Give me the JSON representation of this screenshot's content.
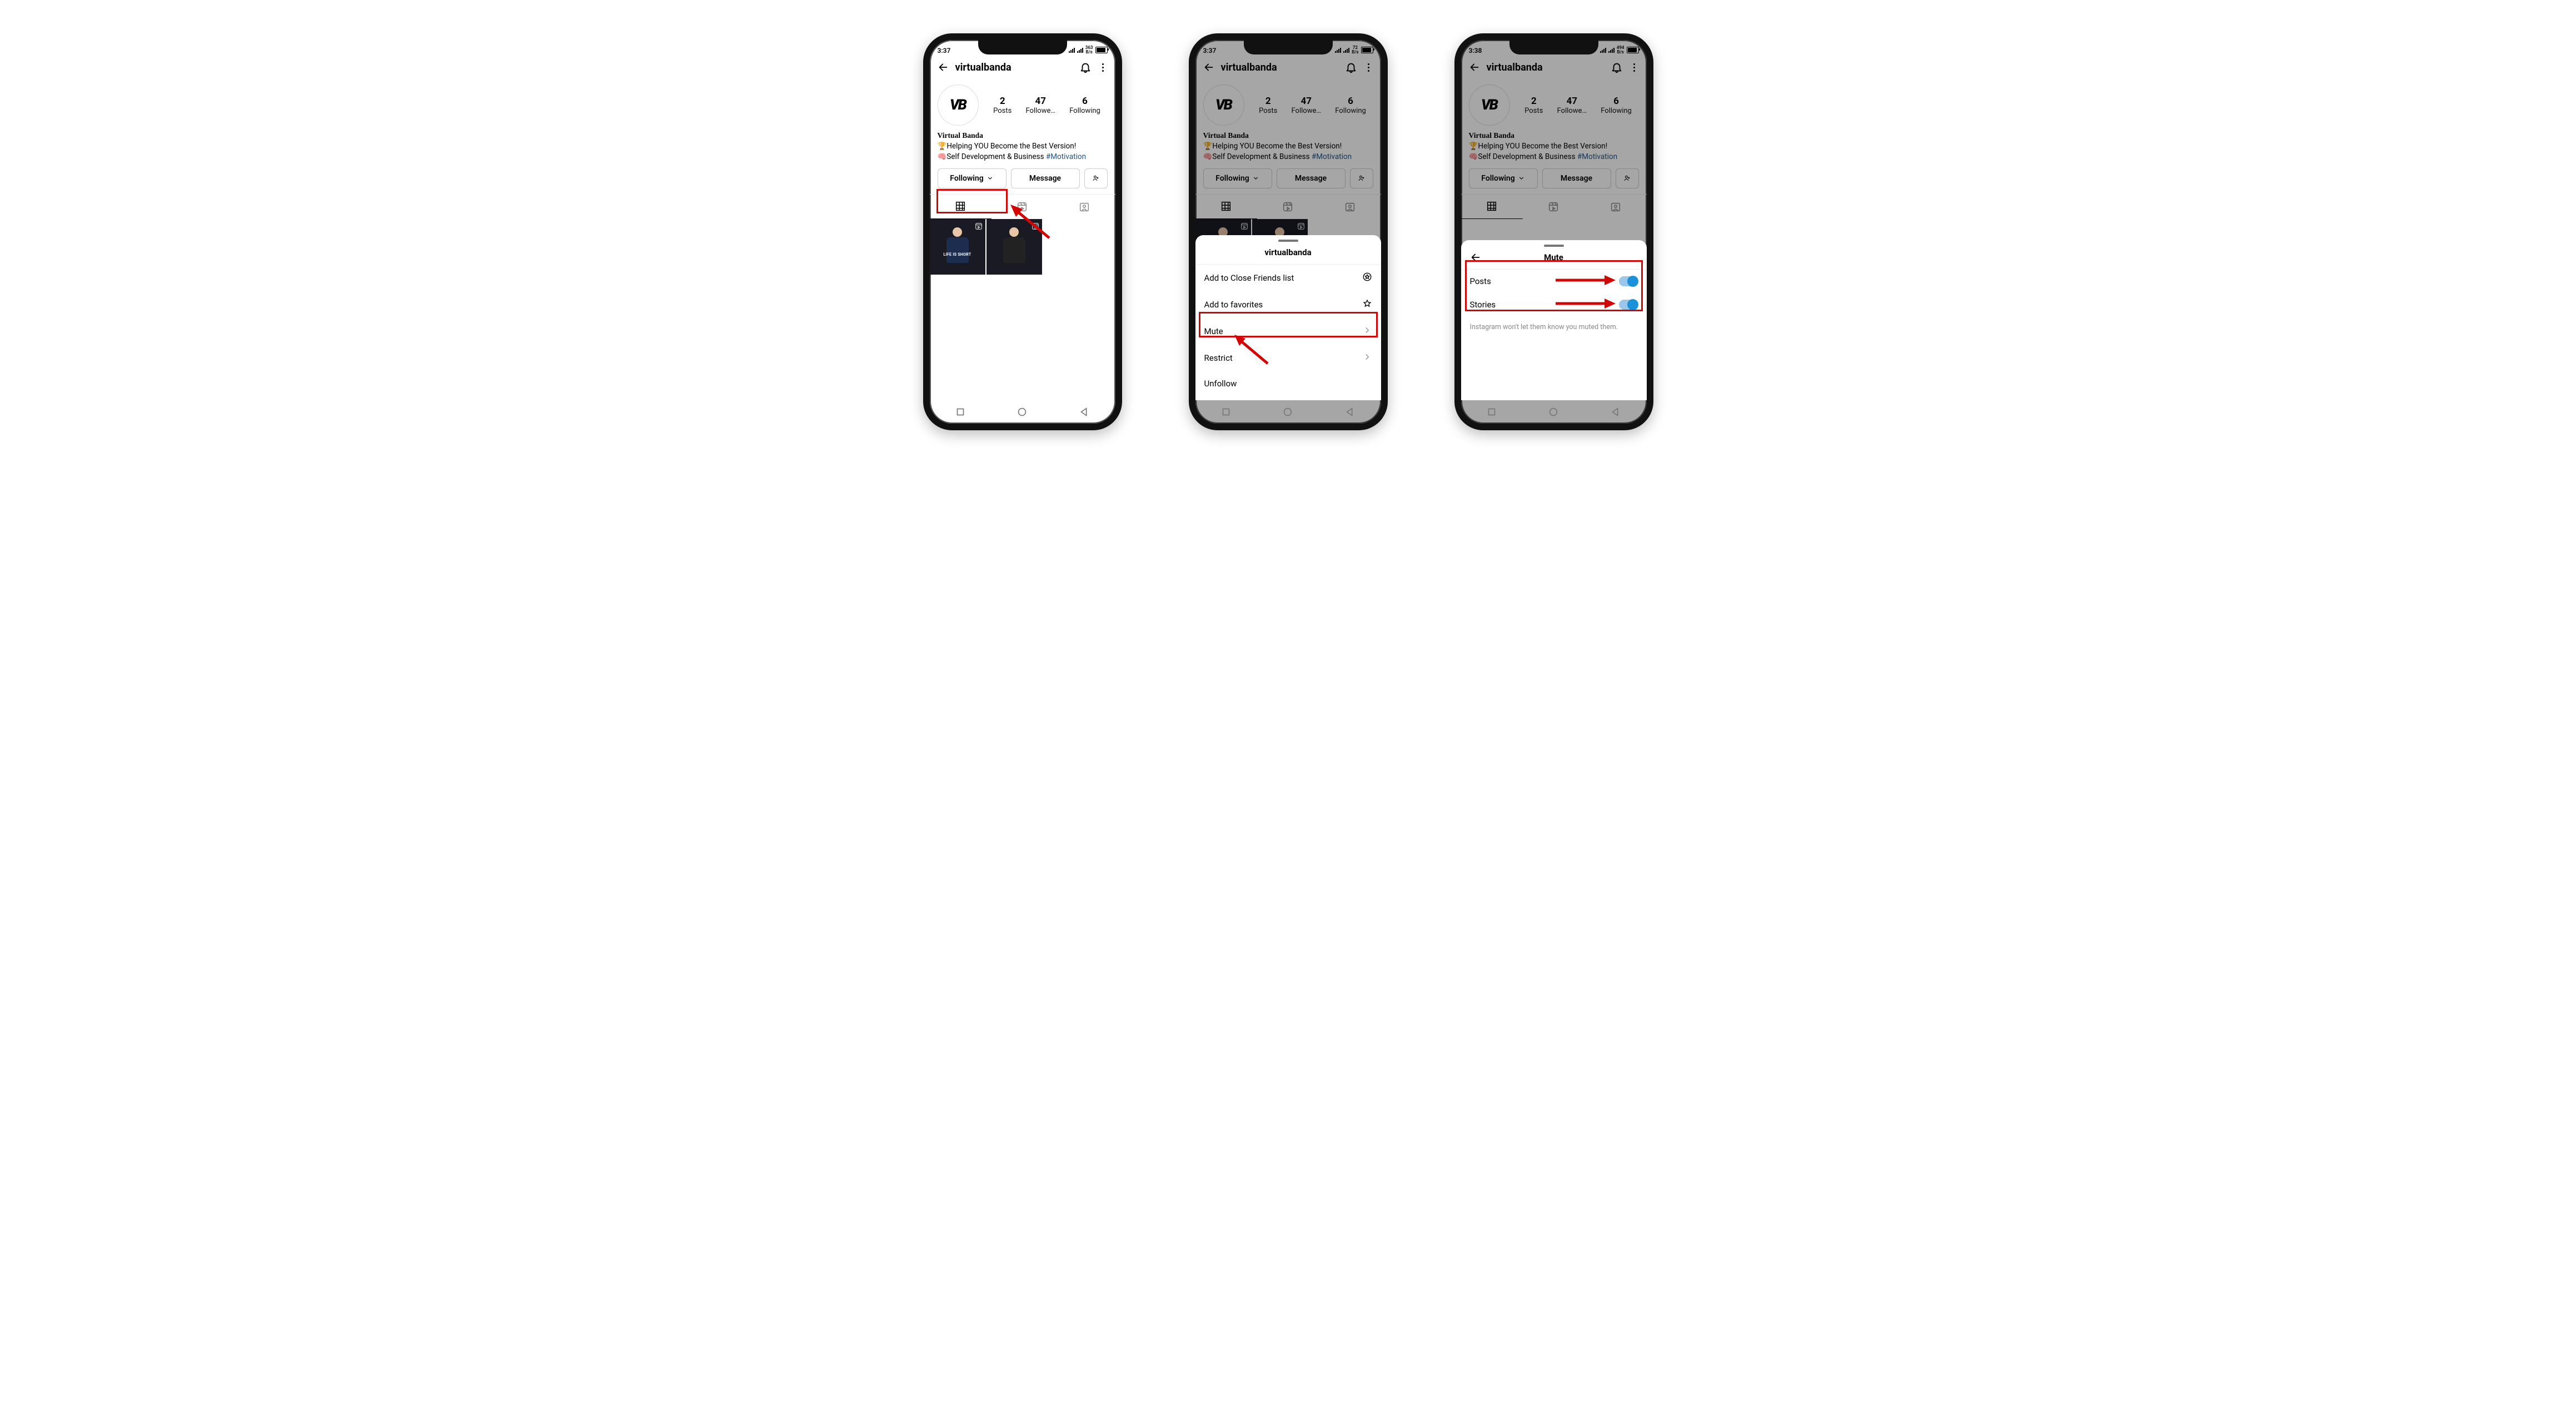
{
  "common": {
    "username": "virtualbanda",
    "avatar_text": "VB",
    "display_name": "Virtual Banda",
    "bio_line1_emoji": "🏆",
    "bio_line1": "Helping YOU Become the Best Version!",
    "bio_line2_emoji": "🧠",
    "bio_line2": "Self Development & Business ",
    "bio_tag": "#Motivation",
    "stats": {
      "posts": {
        "n": "2",
        "l": "Posts"
      },
      "followers": {
        "n": "47",
        "l": "Followe…"
      },
      "following": {
        "n": "6",
        "l": "Following"
      }
    },
    "buttons": {
      "following": "Following",
      "message": "Message"
    },
    "tile1_caption": "LIFE IS SHORT"
  },
  "phone1": {
    "time": "3:37",
    "kbps": "363"
  },
  "phone2": {
    "time": "3:37",
    "kbps": "72",
    "menu": {
      "title": "virtualbanda",
      "close_friends": "Add to Close Friends list",
      "favorites": "Add to favorites",
      "mute": "Mute",
      "restrict": "Restrict",
      "unfollow": "Unfollow"
    }
  },
  "phone3": {
    "time": "3:38",
    "kbps": "494",
    "mute": {
      "title": "Mute",
      "posts": "Posts",
      "stories": "Stories",
      "note": "Instagram won't let them know you muted them."
    }
  }
}
